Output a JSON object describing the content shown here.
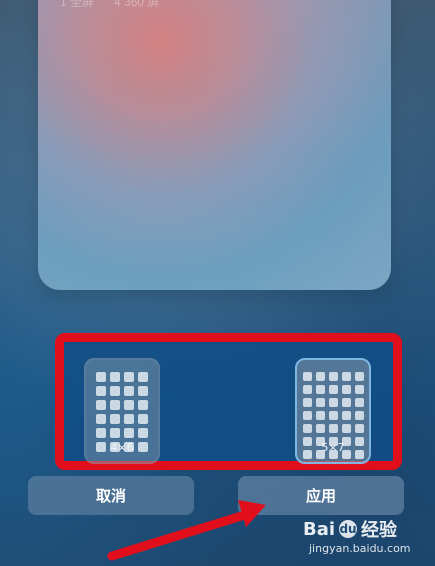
{
  "preview": {
    "top_text": [
      "1 全屏",
      "4 360 屏"
    ]
  },
  "grid_options": [
    {
      "label": "4×6",
      "cols": 4,
      "rows": 6,
      "selected": false
    },
    {
      "label": "5×7",
      "cols": 5,
      "rows": 7,
      "selected": true
    }
  ],
  "buttons": {
    "cancel": "取消",
    "apply": "应用"
  },
  "watermark": {
    "brand_left": "Bai",
    "brand_right": "经验",
    "url": "jingyan.baidu.com"
  },
  "colors": {
    "highlight_red": "#e10f1b",
    "panel_blue": "#114d86"
  }
}
